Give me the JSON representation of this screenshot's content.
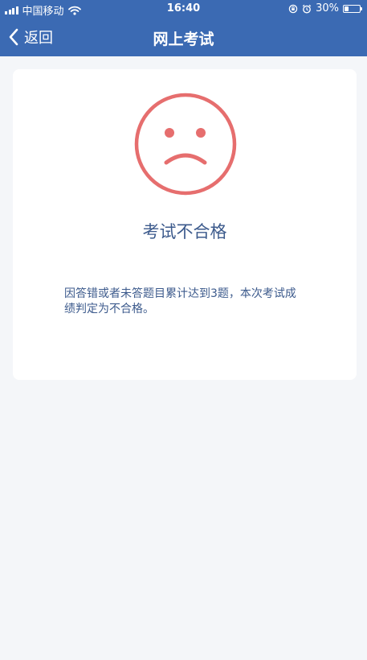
{
  "status_bar": {
    "carrier": "中国移动",
    "time": "16:40",
    "battery_percent": "30%",
    "battery_level": 0.3
  },
  "nav": {
    "back_label": "返回",
    "title": "网上考试"
  },
  "result": {
    "title": "考试不合格",
    "description": "因答错或者未答题目累计达到3题，本次考试成绩判定为不合格。",
    "icon": "sad-face-icon"
  },
  "colors": {
    "header_bg": "#3b6ab3",
    "page_bg": "#f4f6f9",
    "card_bg": "#ffffff",
    "face": "#e66e6e",
    "text": "#3c5a8c"
  }
}
